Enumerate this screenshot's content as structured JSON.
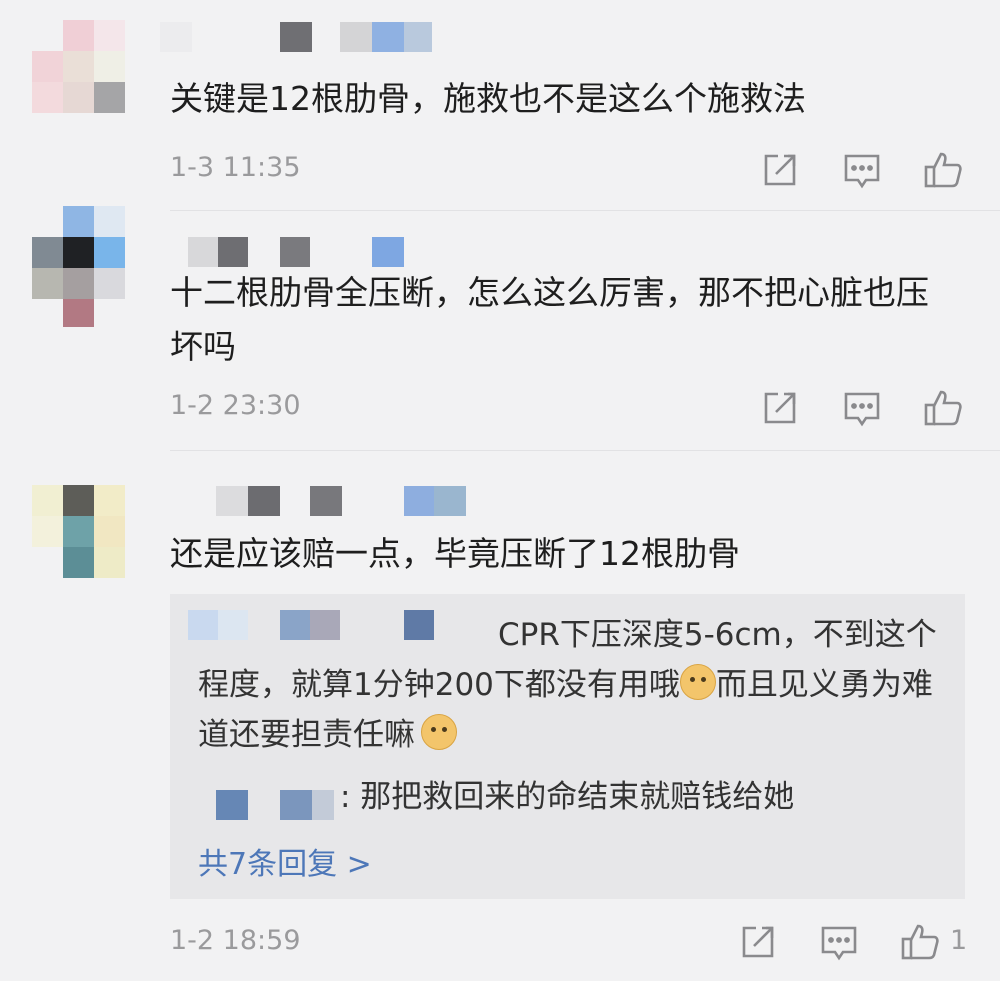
{
  "comments": [
    {
      "text": "关键是12根肋骨，施救也不是这么个施救法",
      "time": "1-3 11:35",
      "like_count": ""
    },
    {
      "text": "十二根肋骨全压断，怎么这么厉害，那不把心脏也压坏吗",
      "time": "1-2 23:30",
      "like_count": ""
    },
    {
      "text": "还是应该赔一点，毕竟压断了12根肋骨",
      "time": "1-2 18:59",
      "like_count": "1",
      "replies": {
        "reply1_part1": "CPR下压深度5-6cm，不到这个程度，就算1分钟200下都没有用哦",
        "reply1_part2": "而且见义勇为难道还要担责任嘛",
        "reply2": ": 那把救回来的命结束就赔钱给她",
        "more_link": "共7条回复 >"
      }
    }
  ],
  "icons": {
    "share": "share-icon",
    "comment": "comment-icon",
    "like": "thumbs-up-icon",
    "emoji": "doge-emoji-icon"
  },
  "colors": {
    "background": "#f2f2f3",
    "reply_box": "#e7e7e9",
    "link": "#4d77b8",
    "meta": "#9a9a9c"
  }
}
